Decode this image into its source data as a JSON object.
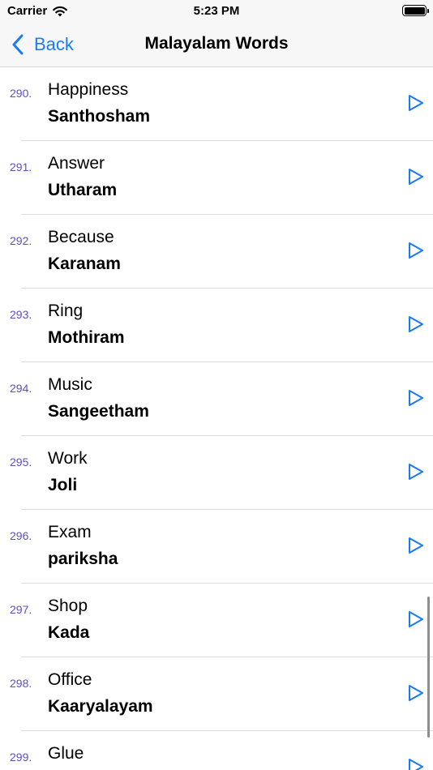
{
  "status_bar": {
    "carrier": "Carrier",
    "time": "5:23 PM"
  },
  "nav": {
    "back_label": "Back",
    "title": "Malayalam Words"
  },
  "colors": {
    "accent": "#1a7cf5",
    "number": "#5b4fc7"
  },
  "words": [
    {
      "number": "290.",
      "english": "Happiness",
      "malayalam": "Santhosham"
    },
    {
      "number": "291.",
      "english": "Answer",
      "malayalam": "Utharam"
    },
    {
      "number": "292.",
      "english": "Because",
      "malayalam": "Karanam"
    },
    {
      "number": "293.",
      "english": "Ring",
      "malayalam": "Mothiram"
    },
    {
      "number": "294.",
      "english": "Music",
      "malayalam": "Sangeetham"
    },
    {
      "number": "295.",
      "english": "Work",
      "malayalam": "Joli"
    },
    {
      "number": "296.",
      "english": "Exam",
      "malayalam": "pariksha"
    },
    {
      "number": "297.",
      "english": "Shop",
      "malayalam": "Kada"
    },
    {
      "number": "298.",
      "english": "Office",
      "malayalam": "Kaaryalayam"
    },
    {
      "number": "299.",
      "english": "Glue",
      "malayalam": ""
    }
  ]
}
